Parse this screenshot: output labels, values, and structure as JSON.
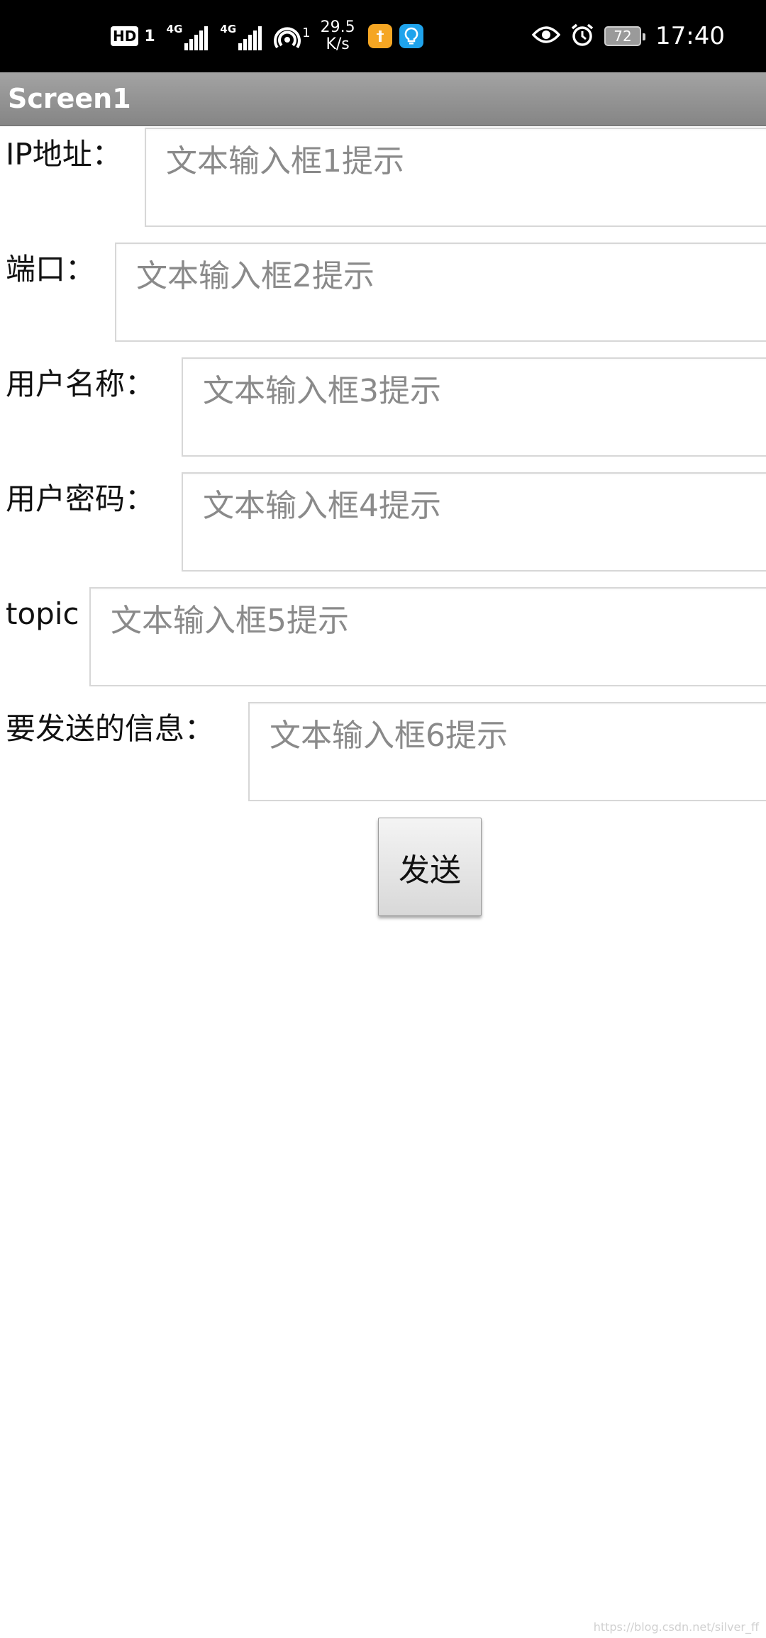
{
  "status_bar": {
    "hd_label": "HD",
    "hd_sub": "1",
    "signal_1_tech": "4G",
    "signal_2_tech": "4G",
    "hotspot_count": "1",
    "net_speed_value": "29.5",
    "net_speed_unit": "K/s",
    "battery_level": "72",
    "time": "17:40",
    "colors": {
      "background": "#000000",
      "foreground": "#ffffff",
      "notif_orange": "#f5a623",
      "notif_blue": "#1fa3ec"
    },
    "icons": [
      "hd-icon",
      "signal-icon",
      "signal-icon",
      "hotspot-icon",
      "app-notification-icon",
      "lightbulb-app-icon",
      "eye-comfort-icon",
      "alarm-icon",
      "battery-icon"
    ]
  },
  "app": {
    "title": "Screen1"
  },
  "form": {
    "fields": [
      {
        "label": "IP地址：",
        "placeholder": "文本输入框1提示",
        "value": ""
      },
      {
        "label": "端口：",
        "placeholder": "文本输入框2提示",
        "value": ""
      },
      {
        "label": "用户名称：",
        "placeholder": "文本输入框3提示",
        "value": ""
      },
      {
        "label": "用户密码：",
        "placeholder": "文本输入框4提示",
        "value": ""
      },
      {
        "label": "topic",
        "placeholder": "文本输入框5提示",
        "value": ""
      },
      {
        "label": "要发送的信息：",
        "placeholder": "文本输入框6提示",
        "value": ""
      }
    ],
    "send_label": "发送"
  },
  "watermark": "https://blog.csdn.net/silver_ff"
}
